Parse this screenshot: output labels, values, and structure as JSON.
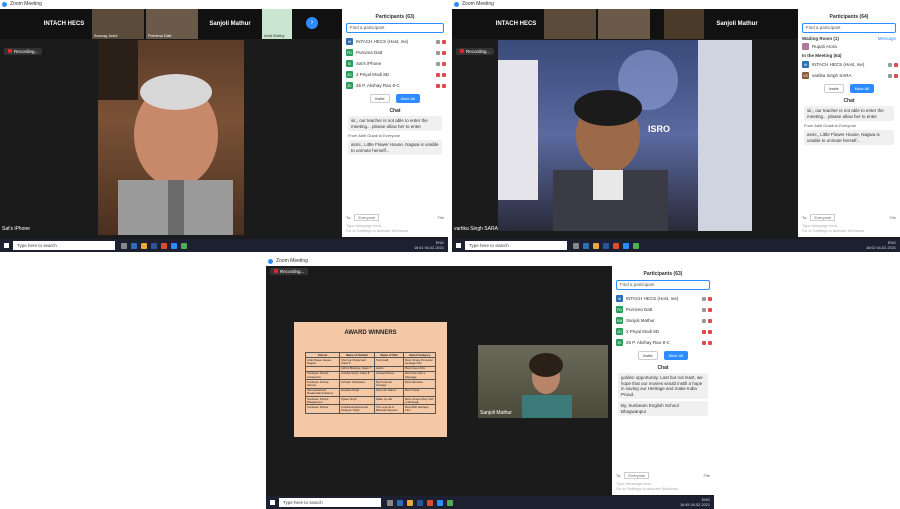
{
  "common": {
    "app_title": "Zoom Meeting",
    "recording": "Recording...",
    "participants_title": "Participants (63)",
    "search_placeholder": "Find a participant",
    "invite": "Invite",
    "mute_all": "Mute All",
    "chat_title": "Chat",
    "to_label": "To:",
    "to_value": "Everyone",
    "file": "File",
    "type_hint": "Type message here...",
    "activate_hint": "Go to Settings to activate Windows.",
    "taskbar_search": "Type here to search",
    "lang": "ENG",
    "date": "04-02-2021"
  },
  "shot1": {
    "strip": [
      {
        "name": "INTACH HECS"
      },
      {
        "name": "Anurag Joshi"
      },
      {
        "name": "Purnima Datt"
      },
      {
        "name": "Sanjoli Mathur"
      },
      {
        "name": "Amit Bobby"
      }
    ],
    "speaker": "Sat's iPhone",
    "participants": [
      {
        "initials": "IH",
        "name": "INTACH HECS (Host, me)",
        "color": "#2d6fb5"
      },
      {
        "initials": "PD",
        "name": "Purnima Datt",
        "color": "#2a9d5a"
      },
      {
        "initials": "SI",
        "name": "Sat's iPhone",
        "color": "#2a9d5a"
      },
      {
        "initials": "2D",
        "name": "2 Priyal Modi 8D",
        "color": "#2a9d5a"
      },
      {
        "initials": "2K",
        "name": "26 P. Akshay Rao 8-C",
        "color": "#2a9d5a"
      }
    ],
    "chat": [
      {
        "text": "sir,, our teacher is not able to enter the meeting... please allow her to enter"
      },
      {
        "text": "asmi,, Little Flower House, Nagwa is unable to unmute herself..."
      }
    ],
    "from": "From Aditi Gulati to Everyone",
    "time": "16:01"
  },
  "shot2": {
    "strip": [
      {
        "name": "INTACH HECS"
      },
      {
        "name": "Sanjoli Mathur"
      }
    ],
    "speaker": "vartika Singh SARA",
    "poster_text": "ISRO",
    "participants_title": "Participants (64)",
    "waiting_label": "Waiting Room (1)",
    "message_btn": "Message",
    "waiting_person": "Rupali Arora",
    "in_meeting_label": "In the Meeting (64)",
    "participants": [
      {
        "initials": "IH",
        "name": "INTACH HECS (Host, me)",
        "color": "#2d6fb5"
      },
      {
        "initials": "VS",
        "name": "vartika Singh SARA",
        "color": "#8a5a3a"
      }
    ],
    "chat": [
      {
        "text": "sir,, our teacher is not able to enter the meeting... please allow her to enter"
      },
      {
        "text": "asmi,, Little Flower House, Nagwa is unable to unmute herself..."
      }
    ],
    "from": "From Aditi Gulati to Everyone",
    "time": "16:02"
  },
  "shot3": {
    "awards_title": "AWARD WINNERS",
    "table_headers": [
      "School",
      "Name of Student",
      "Name of Film",
      "Award Category"
    ],
    "table_rows": [
      [
        "Little Flower House, Nagwa",
        "Shomya Chaturvedi, Class 8",
        "Town Hall",
        "Best Unique Personal Heritage Film"
      ],
      [
        "",
        "Ashmi Bhartiya, Class 7",
        "Herbs",
        "Best Green Film"
      ],
      [
        "Sunbeam School, Annapurna",
        "Ambika Singh, Class 8",
        "Animal Stories",
        "Best Film with a Message"
      ],
      [
        "Sunbeam School, Varuna",
        "Avinash Srivastava",
        "My Personal Heritage",
        "Best Narration"
      ],
      [
        "Sant Atulanand Residential Academy",
        "Hansika Singh",
        "Save the Nature",
        "Best Visual"
      ],
      [
        "Sunbeam School, Bhagwanpur",
        "Ojasvi Singh",
        "Wake up call",
        "Best Unique Story with a Message"
      ],
      [
        "Sunbeam School",
        "Ambika Raghavendra Narayan Singh",
        "The Legend of Banaras Museum",
        "Best Built Heritage Film"
      ]
    ],
    "speaker": "Sanjoli Mathur",
    "participants": [
      {
        "initials": "IH",
        "name": "INTACH HECS (Host, me)",
        "color": "#2d6fb5"
      },
      {
        "initials": "PD",
        "name": "Purnima Datt",
        "color": "#2a9d5a"
      },
      {
        "initials": "SM",
        "name": "Sanjoli Mathur",
        "color": "#2a9d5a"
      },
      {
        "initials": "2D",
        "name": "2 Priyal Modi 8D",
        "color": "#2a9d5a"
      },
      {
        "initials": "2K",
        "name": "26 P. Akshay Rao 8-C",
        "color": "#2a9d5a"
      }
    ],
    "chat": [
      {
        "text": "golden opportunity. Last but not least, we hope that our movies would instill a hope in saving our Heritage and make India Proud."
      },
      {
        "text": "By, Sunbeam English School Bhagwanpur"
      }
    ],
    "time": "16:45"
  }
}
